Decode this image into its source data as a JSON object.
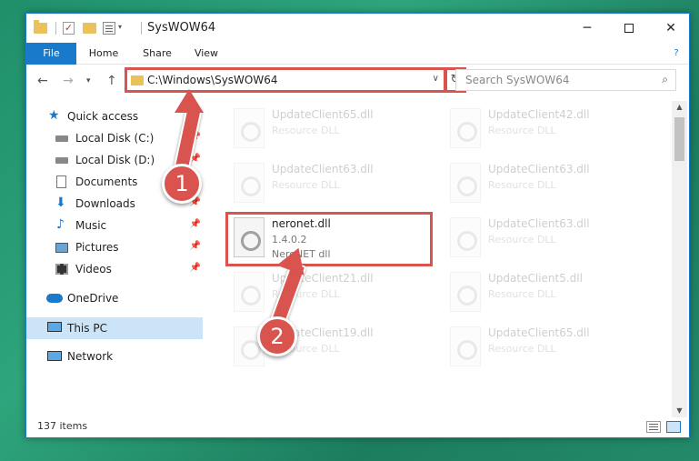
{
  "window": {
    "title": "SysWOW64",
    "controls": {
      "minimize": "─",
      "maximize": "",
      "close": "✕"
    }
  },
  "ribbon": {
    "tabs": [
      "File",
      "Home",
      "Share",
      "View"
    ],
    "expand": "?"
  },
  "address": {
    "path": "C:\\Windows\\SysWOW64",
    "search_placeholder": "Search SysWOW64"
  },
  "sidebar": {
    "items": [
      {
        "label": "Quick access",
        "icon": "star-icon",
        "pinned": false
      },
      {
        "label": "Local Disk (C:)",
        "icon": "drive-icon",
        "pinned": true
      },
      {
        "label": "Local Disk (D:)",
        "icon": "drive-icon",
        "pinned": true
      },
      {
        "label": "Documents",
        "icon": "documents-icon",
        "pinned": true
      },
      {
        "label": "Downloads",
        "icon": "download-icon",
        "pinned": true
      },
      {
        "label": "Music",
        "icon": "music-icon",
        "pinned": true
      },
      {
        "label": "Pictures",
        "icon": "pictures-icon",
        "pinned": true
      },
      {
        "label": "Videos",
        "icon": "videos-icon",
        "pinned": true
      },
      {
        "label": "OneDrive",
        "icon": "cloud-icon",
        "pinned": false
      },
      {
        "label": "This PC",
        "icon": "computer-icon",
        "pinned": false
      },
      {
        "label": "Network",
        "icon": "network-icon",
        "pinned": false
      }
    ]
  },
  "files": [
    {
      "name": "UpdateClient65.dll",
      "line1": "Resource DLL",
      "line2": "",
      "faded": true
    },
    {
      "name": "UpdateClient42.dll",
      "line1": "Resource DLL",
      "line2": "",
      "faded": true
    },
    {
      "name": "UpdateClient63.dll",
      "line1": "Resource DLL",
      "line2": "",
      "faded": true
    },
    {
      "name": "UpdateClient63.dll",
      "line1": "Resource DLL",
      "line2": "",
      "faded": true
    },
    {
      "name": "neronet.dll",
      "line1": "1.4.0.2",
      "line2": "NeroNET dll",
      "faded": false
    },
    {
      "name": "UpdateClient63.dll",
      "line1": "Resource DLL",
      "line2": "",
      "faded": true
    },
    {
      "name": "UpdateClient21.dll",
      "line1": "Resource DLL",
      "line2": "",
      "faded": true
    },
    {
      "name": "UpdateClient5.dll",
      "line1": "Resource DLL",
      "line2": "",
      "faded": true
    },
    {
      "name": "UpdateClient19.dll",
      "line1": "Resource DLL",
      "line2": "",
      "faded": true
    },
    {
      "name": "UpdateClient65.dll",
      "line1": "Resource DLL",
      "line2": "",
      "faded": true
    }
  ],
  "status": {
    "items": "137 items"
  },
  "annotations": {
    "step1": "1",
    "step2": "2",
    "color": "#d9534f"
  }
}
